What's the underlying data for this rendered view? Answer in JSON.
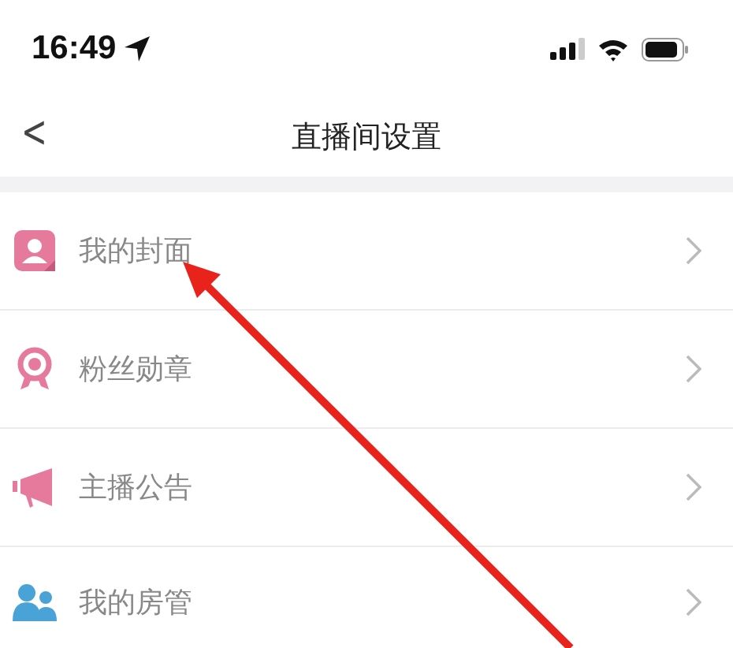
{
  "status_bar": {
    "time": "16:49"
  },
  "nav": {
    "back": "<",
    "title": "直播间设置"
  },
  "items": [
    {
      "kind": "cover",
      "label": "我的封面"
    },
    {
      "kind": "medal",
      "label": "粉丝勋章"
    },
    {
      "kind": "megaphone",
      "label": "主播公告"
    },
    {
      "kind": "people",
      "label": "我的房管"
    }
  ]
}
